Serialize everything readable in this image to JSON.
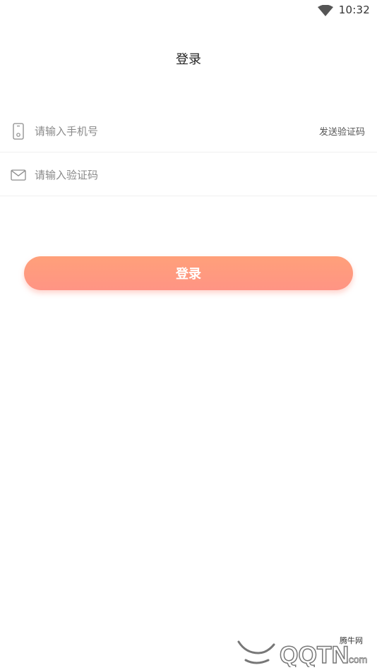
{
  "status_bar": {
    "time": "10:32",
    "wifi_icon": "wifi-icon"
  },
  "header": {
    "title": "登录"
  },
  "form": {
    "phone": {
      "icon": "phone-icon",
      "placeholder": "请输入手机号",
      "value": "",
      "send_code_label": "发送验证码"
    },
    "code": {
      "icon": "mail-icon",
      "placeholder": "请输入验证码",
      "value": ""
    },
    "submit_label": "登录"
  },
  "colors": {
    "button_gradient_top": "#ffa07a",
    "button_gradient_bottom": "#ff9484",
    "button_text": "#ffffff",
    "background": "#ffffff"
  },
  "watermark": {
    "text": "QQTN.com",
    "subtext": "腾牛网"
  }
}
